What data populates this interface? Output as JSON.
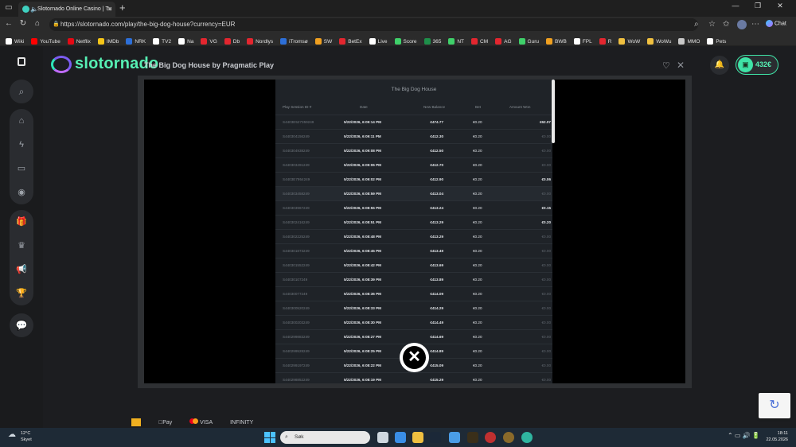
{
  "browser": {
    "tab_title": "Slotornado Online Casino | Tu",
    "url": "https://slotornado.com/play/the-big-dog-house?currency=EUR",
    "chat_label": "Chat",
    "bookmarks": [
      {
        "label": "Wiki",
        "color": "#ffffff"
      },
      {
        "label": "YouTube",
        "color": "#ff0000"
      },
      {
        "label": "Netflix",
        "color": "#e50914"
      },
      {
        "label": "IMDb",
        "color": "#f5c518"
      },
      {
        "label": "NRK",
        "color": "#2d6fd8"
      },
      {
        "label": "TV2",
        "color": "#ffffff"
      },
      {
        "label": "Na",
        "color": "#ffffff"
      },
      {
        "label": "VG",
        "color": "#e3262f"
      },
      {
        "label": "Db",
        "color": "#e3262f"
      },
      {
        "label": "Nordlys",
        "color": "#e3262f"
      },
      {
        "label": "iTromsø",
        "color": "#2d6fd8"
      },
      {
        "label": "SW",
        "color": "#f0a020"
      },
      {
        "label": "BetEx",
        "color": "#e3262f"
      },
      {
        "label": "Live",
        "color": "#ffffff"
      },
      {
        "label": "Score",
        "color": "#3fd06a"
      },
      {
        "label": "365",
        "color": "#1e8f4a"
      },
      {
        "label": "NT",
        "color": "#3fd06a"
      },
      {
        "label": "CM",
        "color": "#e3262f"
      },
      {
        "label": "AG",
        "color": "#e3262f"
      },
      {
        "label": "Guru",
        "color": "#3fd06a"
      },
      {
        "label": "BWB",
        "color": "#f0a020"
      },
      {
        "label": "FPL",
        "color": "#ffffff"
      },
      {
        "label": "R",
        "color": "#e3262f"
      },
      {
        "label": "WoW",
        "color": "#f0c040"
      },
      {
        "label": "WoWu",
        "color": "#f0c040"
      },
      {
        "label": "MMO",
        "color": "#c8c8c8"
      },
      {
        "label": "Pets",
        "color": "#ffffff"
      }
    ]
  },
  "site": {
    "brand": "slotornado",
    "game_title": "The Big Dog House by Pragmatic Play",
    "balance": "432€",
    "accent": "#56f0b4"
  },
  "history": {
    "title": "The Big Dog House",
    "columns": [
      "Play Session ID #",
      "Date",
      "New Balance",
      "Bet",
      "Amount Won"
    ],
    "rows": [
      {
        "id": "S4403E527359249",
        "date": "5/22/2026, 6:09:14 PM",
        "balance": "€474.77",
        "bet": "€0.20",
        "won": "€62.07",
        "positive": true
      },
      {
        "id": "S440304156249",
        "date": "5/22/2026, 6:09:11 PM",
        "balance": "€412.30",
        "bet": "€0.20",
        "won": "€0.00",
        "positive": false
      },
      {
        "id": "S440304938249",
        "date": "5/22/2026, 6:09:08 PM",
        "balance": "€412.50",
        "bet": "€0.20",
        "won": "€0.00",
        "positive": false
      },
      {
        "id": "S440303491249",
        "date": "5/22/2026, 6:09:06 PM",
        "balance": "€412.70",
        "bet": "€0.20",
        "won": "€0.00",
        "positive": false
      },
      {
        "id": "S4403E7954249",
        "date": "5/22/2026, 6:09:02 PM",
        "balance": "€412.90",
        "bet": "€0.20",
        "won": "€0.06",
        "positive": true
      },
      {
        "id": "S440303458249",
        "date": "5/22/2026, 6:08:59 PM",
        "balance": "€413.04",
        "bet": "€0.20",
        "won": "€0.00",
        "positive": false
      },
      {
        "id": "S440303967249",
        "date": "5/22/2026, 6:08:55 PM",
        "balance": "€413.24",
        "bet": "€0.20",
        "won": "€0.15",
        "positive": true
      },
      {
        "id": "S440302416249",
        "date": "5/22/2026, 6:08:51 PM",
        "balance": "€413.29",
        "bet": "€0.20",
        "won": "€0.20",
        "positive": true
      },
      {
        "id": "S440302225249",
        "date": "5/22/2026, 6:08:48 PM",
        "balance": "€413.29",
        "bet": "€0.20",
        "won": "€0.00",
        "positive": false
      },
      {
        "id": "S440301873249",
        "date": "5/22/2026, 6:08:45 PM",
        "balance": "€413.49",
        "bet": "€0.20",
        "won": "€0.00",
        "positive": false
      },
      {
        "id": "S440301552249",
        "date": "5/22/2026, 6:08:42 PM",
        "balance": "€413.69",
        "bet": "€0.20",
        "won": "€0.00",
        "positive": false
      },
      {
        "id": "S44030107249",
        "date": "5/22/2026, 6:08:39 PM",
        "balance": "€413.89",
        "bet": "€0.20",
        "won": "€0.00",
        "positive": false
      },
      {
        "id": "S44030077249",
        "date": "5/22/2026, 6:08:36 PM",
        "balance": "€414.09",
        "bet": "€0.20",
        "won": "€0.00",
        "positive": false
      },
      {
        "id": "S440300520249",
        "date": "5/22/2026, 6:08:33 PM",
        "balance": "€414.29",
        "bet": "€0.20",
        "won": "€0.00",
        "positive": false
      },
      {
        "id": "S440300203249",
        "date": "5/22/2026, 6:08:30 PM",
        "balance": "€414.49",
        "bet": "€0.20",
        "won": "€0.00",
        "positive": false
      },
      {
        "id": "S440299883249",
        "date": "5/22/2026, 6:08:27 PM",
        "balance": "€414.69",
        "bet": "€0.20",
        "won": "€0.00",
        "positive": false
      },
      {
        "id": "S440299528249",
        "date": "5/22/2026, 6:08:25 PM",
        "balance": "€414.89",
        "bet": "€0.20",
        "won": "€0.00",
        "positive": false
      },
      {
        "id": "S440299197249",
        "date": "5/22/2026, 6:08:22 PM",
        "balance": "€415.09",
        "bet": "€0.20",
        "won": "€0.00",
        "positive": false
      },
      {
        "id": "S440298852249",
        "date": "5/22/2026, 6:08:19 PM",
        "balance": "€415.29",
        "bet": "€0.20",
        "won": "€0.00",
        "positive": false
      }
    ]
  },
  "payments": [
    "Pay",
    "VISA",
    "INFINITY"
  ],
  "taskbar": {
    "temperature": "12°C",
    "weather": "Skyet",
    "search_placeholder": "Søk",
    "time": "18:11",
    "date": "22.05.2026"
  }
}
